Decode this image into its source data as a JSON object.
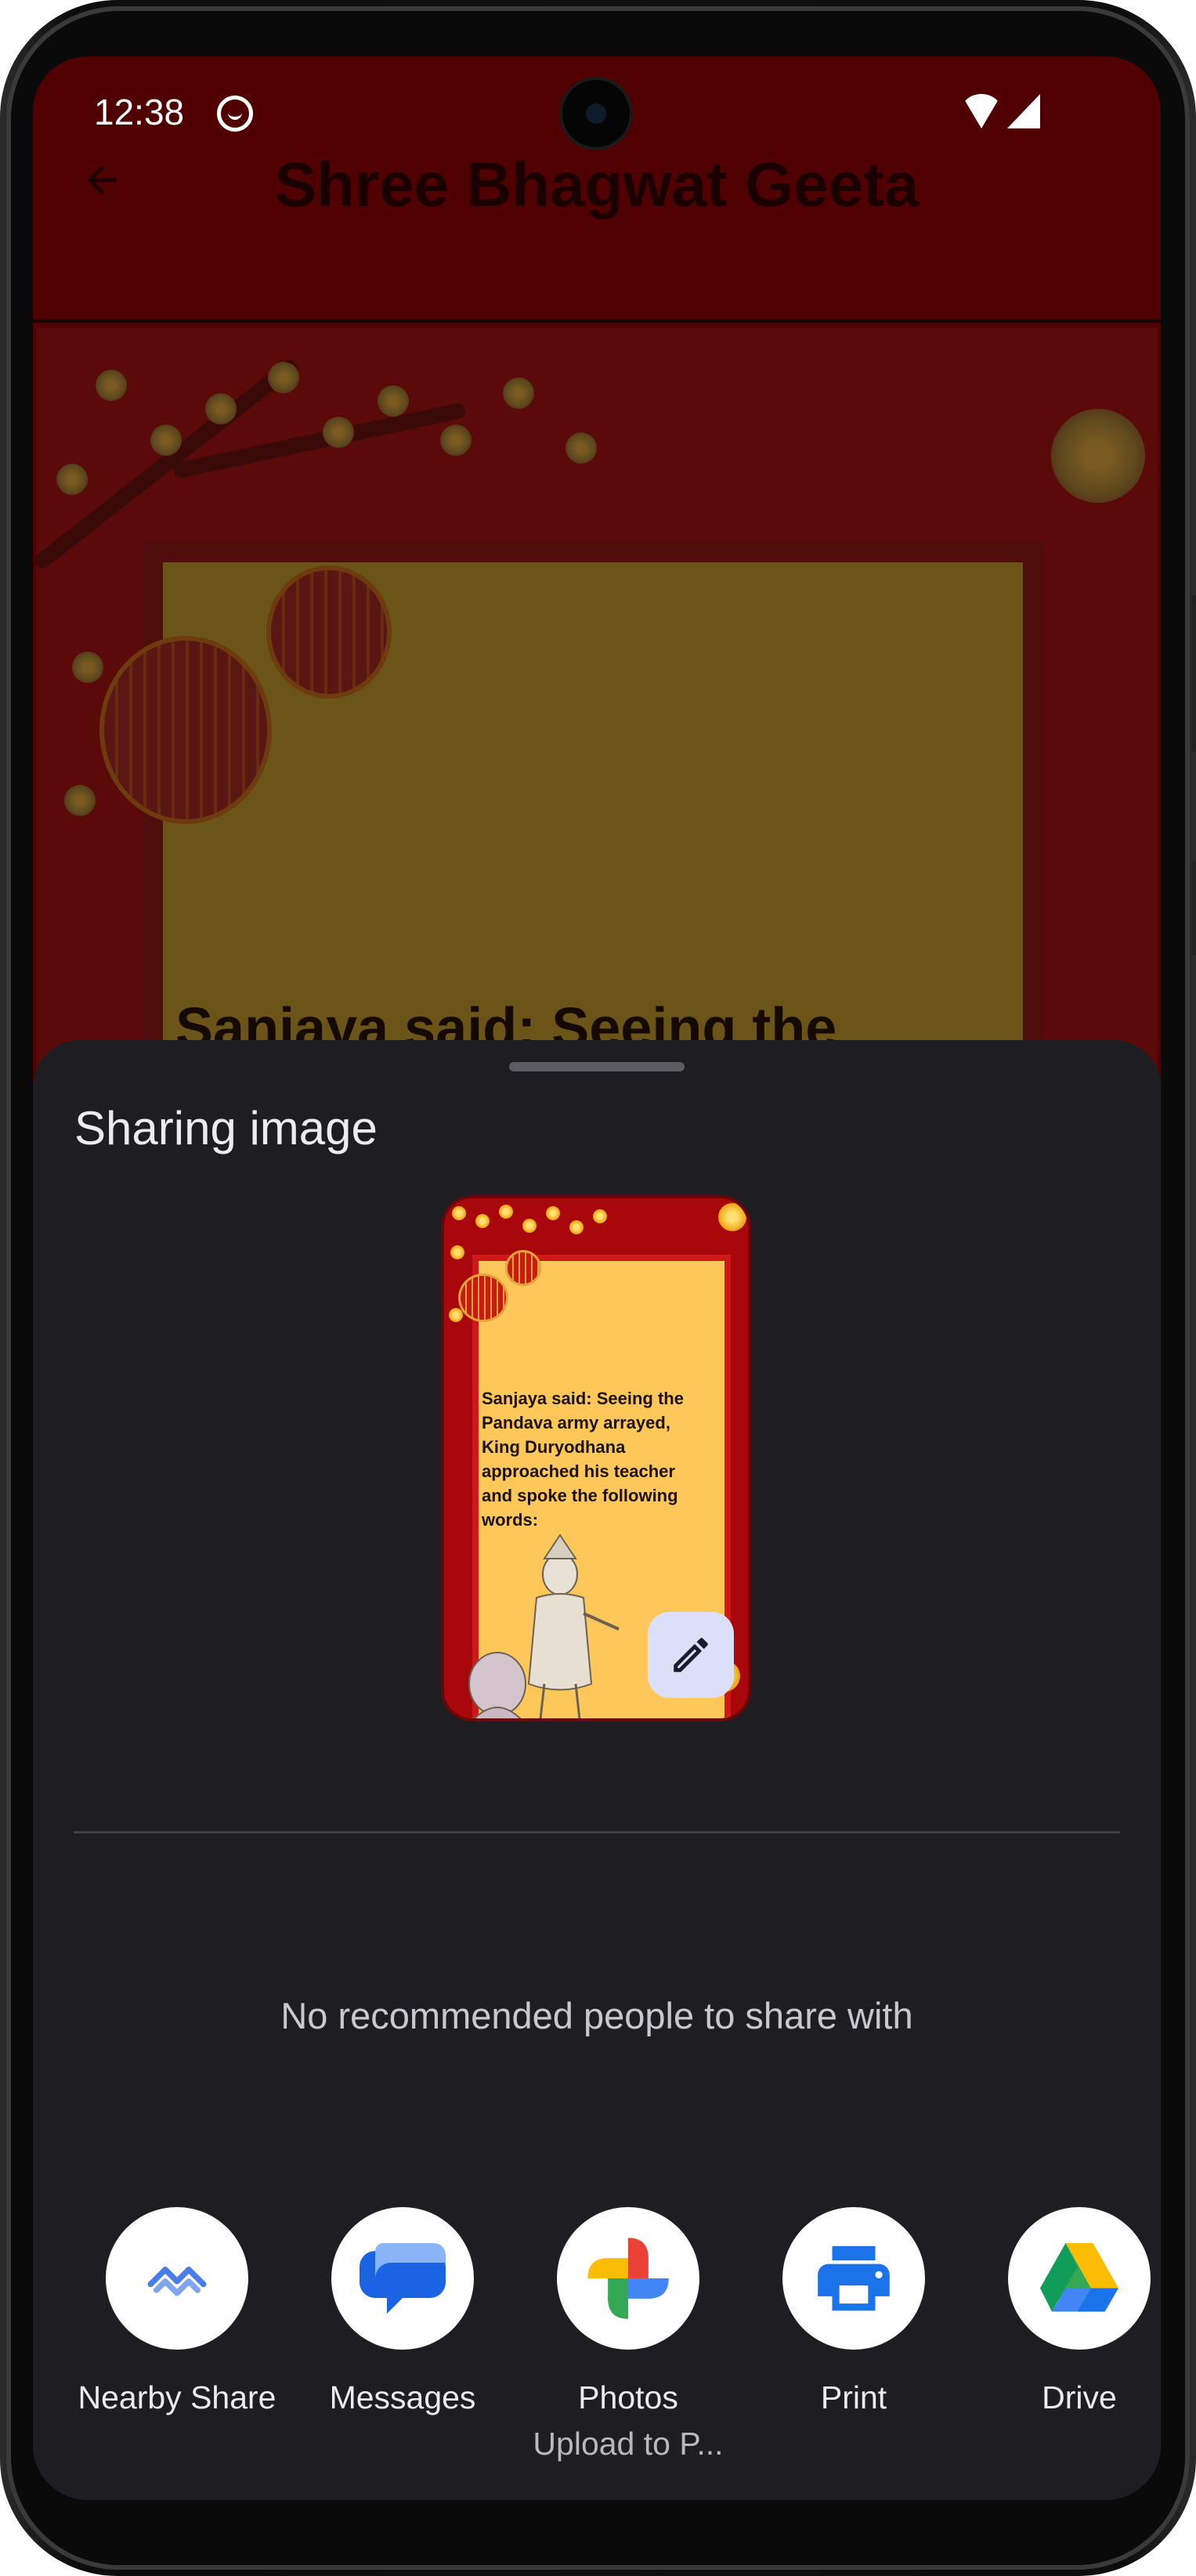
{
  "status_bar": {
    "time": "12:38"
  },
  "app": {
    "title": "Shree Bhagwat Geeta",
    "card_text_visible": "Sanjaya said: Seeing the"
  },
  "share_sheet": {
    "title": "Sharing image",
    "preview_text": "Sanjaya said: Seeing the Pandava army arrayed, King Duryodhana approached his teacher and spoke the following words:",
    "empty_people_message": "No recommended people to share with",
    "targets": [
      {
        "label": "Nearby Share",
        "sublabel": "",
        "icon": "nearby-share-icon"
      },
      {
        "label": "Messages",
        "sublabel": "",
        "icon": "messages-icon"
      },
      {
        "label": "Photos",
        "sublabel": "Upload to P...",
        "icon": "photos-icon"
      },
      {
        "label": "Print",
        "sublabel": "",
        "icon": "print-icon"
      },
      {
        "label": "Drive",
        "sublabel": "",
        "icon": "drive-icon"
      }
    ]
  },
  "colors": {
    "sheet_background": "#1e1e22",
    "scrim_app_background": "#500000",
    "preview_frame": "#a8070c",
    "preview_panel": "#fdc75a",
    "edit_button": "#dcdff8"
  }
}
